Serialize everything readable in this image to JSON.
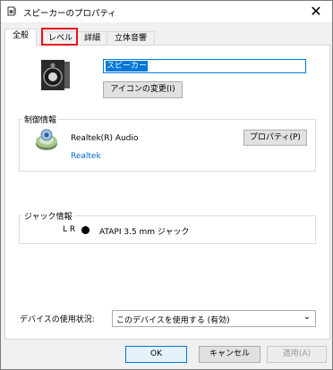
{
  "window": {
    "title": "スピーカーのプロパティ"
  },
  "tabs": [
    {
      "label": "全般",
      "active": true
    },
    {
      "label": "レベル",
      "highlighted": true
    },
    {
      "label": "詳細"
    },
    {
      "label": "立体音響"
    }
  ],
  "general": {
    "device_name": "スピーカー",
    "change_icon_label": "アイコンの変更(I)"
  },
  "controller": {
    "group_label": "制御情報",
    "name": "Realtek(R) Audio",
    "vendor_link": "Realtek",
    "properties_label": "プロパティ(P)"
  },
  "jack": {
    "group_label": "ジャック情報",
    "channels": "L R",
    "description": "ATAPI 3.5 mm ジャック",
    "jack_color": "#000000"
  },
  "usage": {
    "label": "デバイスの使用状況:",
    "selected": "このデバイスを使用する (有効)"
  },
  "buttons": {
    "ok": "OK",
    "cancel": "キャンセル",
    "apply": "適用(A)"
  },
  "colors": {
    "accent": "#0078d7",
    "highlight_box": "#e8111c"
  }
}
